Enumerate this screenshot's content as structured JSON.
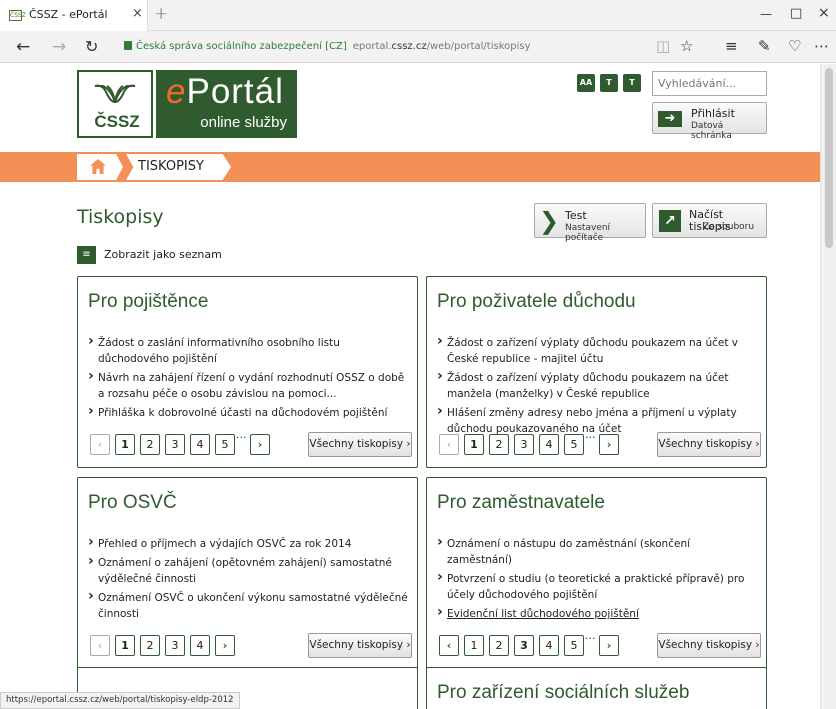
{
  "browser": {
    "tab_title": "ČSSZ - ePortál",
    "favicon": "ČSSZ",
    "close_tab": "×",
    "new_tab": "+",
    "site_name": "Česká správa sociálního zabezpečení [CZ]",
    "url_prefix": "eportal.",
    "url_domain": "cssz.cz",
    "url_path": "/web/portal/tiskopisy",
    "status_url": "https://eportal.cssz.cz/web/portal/tiskopisy-eldp-2012"
  },
  "header": {
    "logo_text": "ČSSZ",
    "eportal_e": "e",
    "eportal_rest": "Portál",
    "online": "online služby",
    "font_a1": "AA",
    "font_a2": "T",
    "font_a3": "T",
    "search_placeholder": "Vyhledávání...",
    "login_l1": "Přihlásit",
    "login_l2": "Datová schránka"
  },
  "breadcrumb": {
    "current": "TISKOPISY"
  },
  "page": {
    "title": "Tiskopisy",
    "list_view": "Zobrazit jako seznam",
    "test_l1": "Test",
    "test_l2": "Nastavení počítače",
    "load_l1": "Načíst tiskopis",
    "load_l2": "Ze souboru"
  },
  "cards": [
    {
      "title": "Pro pojištěnce",
      "items": [
        "Žádost o zaslání informativního osobního listu důchodového pojištění",
        "Návrh na zahájení řízení o vydání rozhodnutí OSSZ o době a rozsahu péče o osobu závislou na pomoci...",
        "Přihláška k dobrovolné účasti na důchodovém pojištění"
      ],
      "pages": [
        "1",
        "2",
        "3",
        "4",
        "5"
      ],
      "all": "Všechny tiskopisy ›"
    },
    {
      "title": "Pro poživatele důchodu",
      "items": [
        "Žádost o zařízení výplaty důchodu poukazem na účet v České republice - majitel účtu",
        "Žádost o zařízení výplaty důchodu poukazem na účet manžela (manželky) v České republice",
        "Hlášení změny adresy nebo jména a příjmení u výplaty důchodu poukazovaného na účet"
      ],
      "pages": [
        "1",
        "2",
        "3",
        "4",
        "5"
      ],
      "all": "Všechny tiskopisy ›"
    },
    {
      "title": "Pro OSVČ",
      "items": [
        "Přehled o příjmech a výdajích OSVČ za rok 2014",
        "Oznámení o zahájení (opětovném zahájení) samostatné výdělečné činnosti",
        "Oznámení OSVČ o ukončení výkonu samostatné výdělečné činnosti"
      ],
      "pages": [
        "1",
        "2",
        "3",
        "4"
      ],
      "all": "Všechny tiskopisy ›"
    },
    {
      "title": "Pro zaměstnavatele",
      "items": [
        "Oznámení o nástupu do zaměstnání (skončení zaměstnání)",
        "Potvrzení o studiu (o teoretické a praktické přípravě) pro účely důchodového pojištění",
        "Evidenční list důchodového pojištění"
      ],
      "pages": [
        "1",
        "2",
        "3",
        "4",
        "5"
      ],
      "all": "Všechny tiskopisy ›"
    },
    {
      "title": "Pro zařízení sociálních služeb"
    }
  ],
  "pager": {
    "prev": "‹",
    "next": "›",
    "dots": "···"
  }
}
